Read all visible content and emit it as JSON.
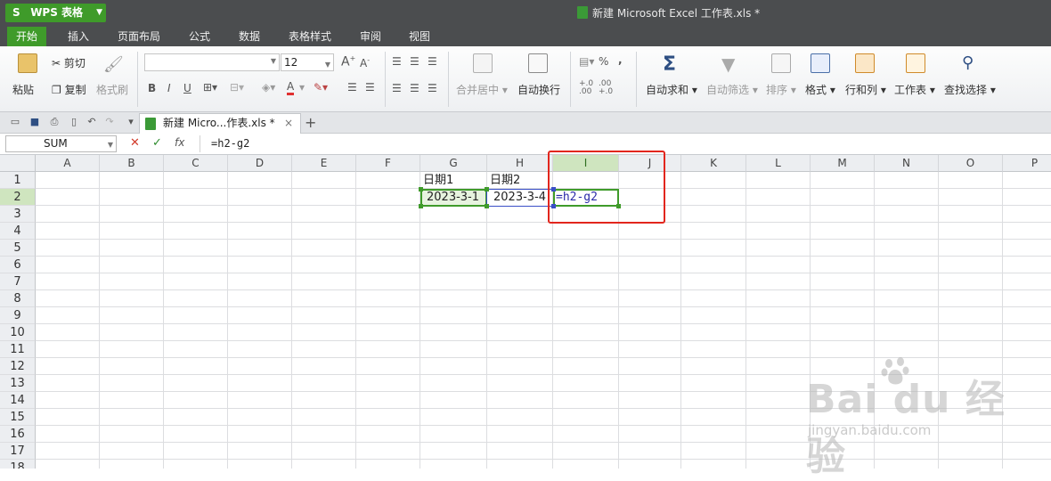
{
  "app": {
    "name": "WPS 表格",
    "logo_glyph": "S",
    "window_title": "新建 Microsoft Excel 工作表.xls *"
  },
  "menu": {
    "tabs": [
      "开始",
      "插入",
      "页面布局",
      "公式",
      "数据",
      "表格样式",
      "审阅",
      "视图"
    ],
    "active": "开始"
  },
  "ribbon": {
    "cut": "剪切",
    "paste": "粘贴",
    "copy": "复制",
    "format_painter": "格式刷",
    "font_name": "",
    "font_size": "12",
    "bold": "B",
    "italic": "I",
    "underline": "U",
    "merge_center": "合并居中",
    "wrap_text": "自动换行",
    "percent": "%",
    "comma": ",",
    "autosum": "自动求和",
    "autofilter": "自动筛选",
    "sort": "排序",
    "format": "格式",
    "rows_cols": "行和列",
    "worksheet": "工作表",
    "find_select": "查找选择",
    "sum_glyph": "Σ"
  },
  "doc_tab": {
    "label": "新建 Micro...作表.xls *",
    "close": "×",
    "new": "+"
  },
  "formula_bar": {
    "name_box": "SUM",
    "cancel": "✕",
    "confirm": "✓",
    "fx": "fx",
    "formula": "=h2-g2"
  },
  "sheet": {
    "columns": [
      "A",
      "B",
      "C",
      "D",
      "E",
      "F",
      "G",
      "H",
      "I",
      "J",
      "K",
      "L",
      "M",
      "N",
      "O",
      "P"
    ],
    "selected_column": "I",
    "rows": [
      "1",
      "2",
      "3",
      "4",
      "5",
      "6",
      "7",
      "8",
      "9",
      "10",
      "11",
      "12",
      "13",
      "14",
      "15",
      "16",
      "17",
      "18"
    ],
    "selected_row": "2",
    "cells": {
      "G1": "日期1",
      "H1": "日期2",
      "G2": "2023-3-1",
      "H2": "2023-3-4",
      "I2": "=h2-g2"
    }
  },
  "colors": {
    "accent": "#3f9b2a",
    "title_bg": "#4b4d4f",
    "highlight_box": "#e2261d",
    "ref_blue": "#3a4fc7"
  },
  "watermark": {
    "logo": "Bai du 经验",
    "url": "jingyan.baidu.com"
  }
}
